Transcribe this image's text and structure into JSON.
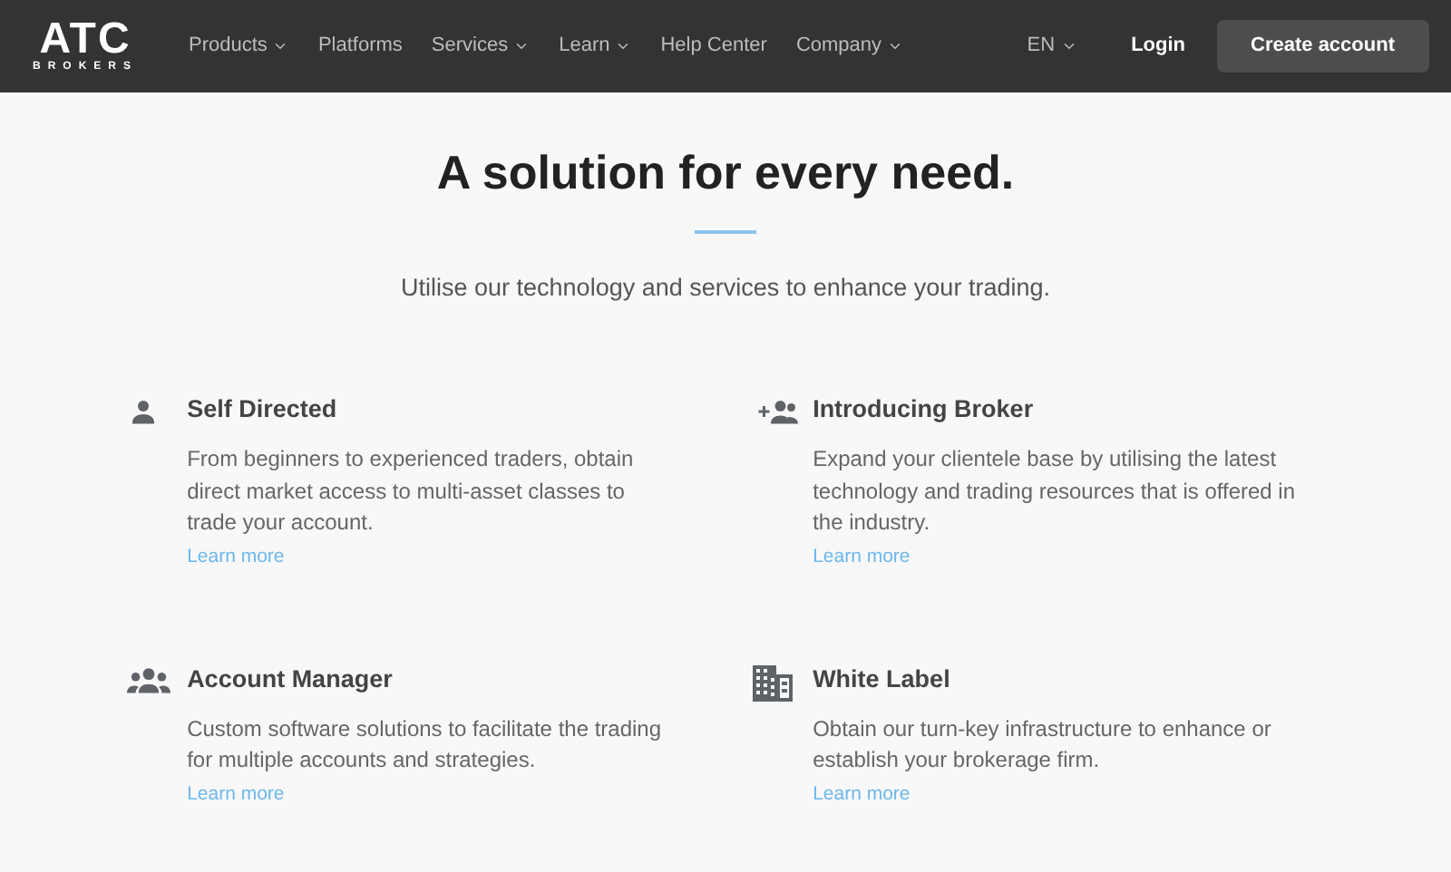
{
  "logo": {
    "name": "ATC",
    "tagline": "BROKERS"
  },
  "nav": [
    {
      "label": "Products",
      "has_menu": true
    },
    {
      "label": "Platforms",
      "has_menu": false
    },
    {
      "label": "Services",
      "has_menu": true
    },
    {
      "label": "Learn",
      "has_menu": true
    },
    {
      "label": "Help Center",
      "has_menu": false
    },
    {
      "label": "Company",
      "has_menu": true
    }
  ],
  "language": {
    "label": "EN"
  },
  "login": "Login",
  "create_account": "Create account",
  "heading": "A solution for every need.",
  "subtitle": "Utilise our technology and services to enhance your trading.",
  "solutions": [
    {
      "kind": "person",
      "title": "Self Directed",
      "description": "From beginners to experienced traders, obtain direct market access to multi-asset classes to trade your account.",
      "link": "Learn more"
    },
    {
      "kind": "add-group",
      "title": "Introducing Broker",
      "description": "Expand your clientele base by utilising the latest technology and trading resources that is offered in the industry.",
      "link": "Learn more"
    },
    {
      "kind": "group",
      "title": "Account Manager",
      "description": "Custom software solutions to facilitate the trading for multiple accounts and strategies.",
      "link": "Learn more"
    },
    {
      "kind": "building",
      "title": "White Label",
      "description": "Obtain our turn-key infrastructure to enhance or establish your brokerage firm.",
      "link": "Learn more"
    }
  ]
}
